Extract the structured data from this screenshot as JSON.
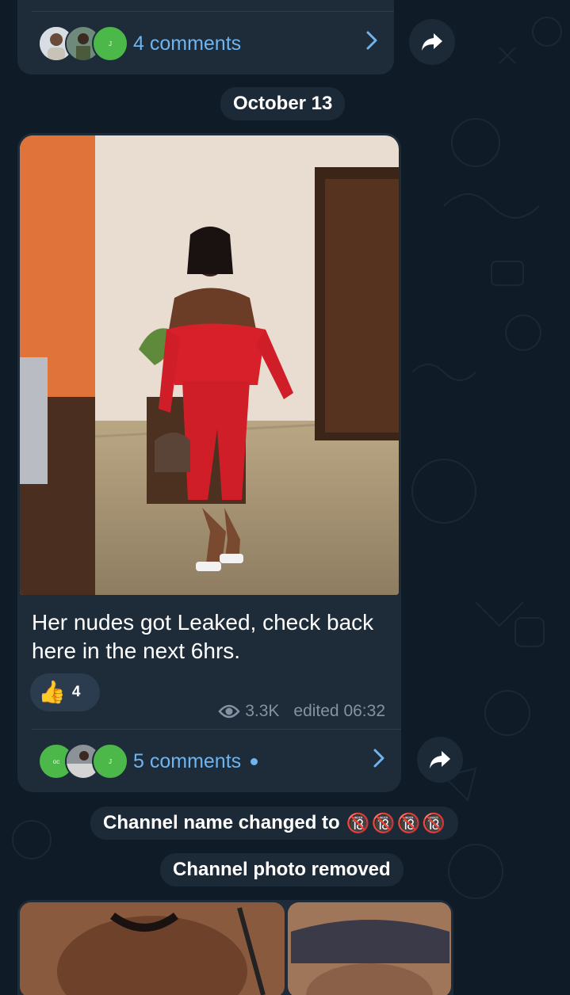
{
  "top_post": {
    "comments_label": "4 comments"
  },
  "date_separator": "October 13",
  "post": {
    "caption": "Her nudes got Leaked, check back here in the next 6hrs.",
    "reaction_emoji": "👍",
    "reaction_count": "4",
    "views": "3.3K",
    "edited_time": "edited 06:32",
    "comments_label": "5 comments"
  },
  "service": {
    "name_changed_prefix": "Channel name changed to",
    "name_changed_emojis": [
      "🔞",
      "🔞",
      "🔞",
      "🔞"
    ],
    "photo_removed": "Channel photo removed"
  },
  "icons": {
    "forward": "forward-arrow-icon",
    "chevron": "chevron-right-icon",
    "views": "eye-icon"
  },
  "colors": {
    "background": "#0f1b26",
    "bubble": "#1e2c3a",
    "link": "#6fb4ef",
    "meta": "#8393a3",
    "avatar_green": "#4cb84a"
  }
}
